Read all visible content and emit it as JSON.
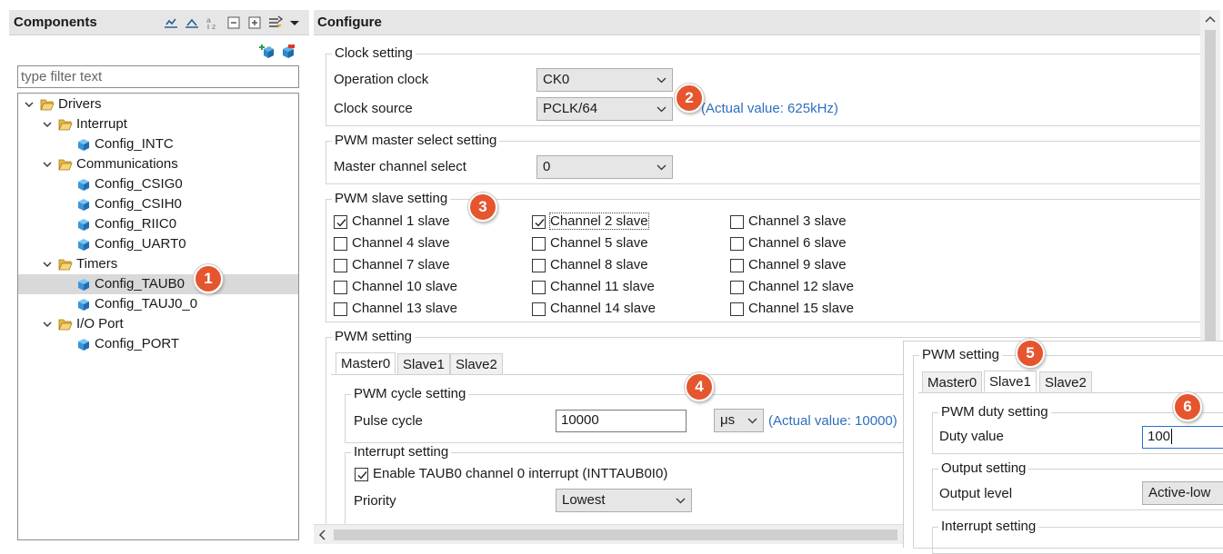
{
  "components": {
    "title": "Components",
    "filter_placeholder": "type filter text",
    "tree": [
      {
        "label": "Drivers"
      },
      {
        "label": "Interrupt"
      },
      {
        "label": "Config_INTC"
      },
      {
        "label": "Communications"
      },
      {
        "label": "Config_CSIG0"
      },
      {
        "label": "Config_CSIH0"
      },
      {
        "label": "Config_RIIC0"
      },
      {
        "label": "Config_UART0"
      },
      {
        "label": "Timers"
      },
      {
        "label": "Config_TAUB0"
      },
      {
        "label": "Config_TAUJ0_0"
      },
      {
        "label": "I/O Port"
      },
      {
        "label": "Config_PORT"
      }
    ]
  },
  "badges": [
    "1",
    "2",
    "3",
    "4",
    "5",
    "6"
  ],
  "configure": {
    "title": "Configure",
    "clock": {
      "legend": "Clock setting",
      "operation_clock_label": "Operation clock",
      "operation_clock_value": "CK0",
      "clock_source_label": "Clock source",
      "clock_source_value": "PCLK/64",
      "actual_value": "(Actual value: 625kHz)"
    },
    "master_select": {
      "legend": "PWM master select setting",
      "label": "Master channel select",
      "value": "0"
    },
    "slave": {
      "legend": "PWM slave setting",
      "channels": [
        {
          "label": "Channel 1 slave",
          "checked": true
        },
        {
          "label": "Channel 2 slave",
          "checked": true
        },
        {
          "label": "Channel 3 slave",
          "checked": false
        },
        {
          "label": "Channel 4 slave",
          "checked": false
        },
        {
          "label": "Channel 5 slave",
          "checked": false
        },
        {
          "label": "Channel 6 slave",
          "checked": false
        },
        {
          "label": "Channel 7 slave",
          "checked": false
        },
        {
          "label": "Channel 8 slave",
          "checked": false
        },
        {
          "label": "Channel 9 slave",
          "checked": false
        },
        {
          "label": "Channel 10 slave",
          "checked": false
        },
        {
          "label": "Channel 11 slave",
          "checked": false
        },
        {
          "label": "Channel 12 slave",
          "checked": false
        },
        {
          "label": "Channel 13 slave",
          "checked": false
        },
        {
          "label": "Channel 14 slave",
          "checked": false
        },
        {
          "label": "Channel 15 slave",
          "checked": false
        }
      ]
    },
    "pwm": {
      "legend": "PWM setting",
      "tabs": [
        "Master0",
        "Slave1",
        "Slave2"
      ],
      "active_tab": "Master0",
      "cycle": {
        "legend": "PWM cycle setting",
        "pulse_label": "Pulse cycle",
        "pulse_value": "10000",
        "unit": "μs",
        "actual_value": "(Actual value: 10000)"
      },
      "interrupt": {
        "legend": "Interrupt setting",
        "enable_label": "Enable TAUB0 channel 0 interrupt (INTTAUB0I0)",
        "enable_checked": true,
        "priority_label": "Priority",
        "priority_value": "Lowest"
      }
    }
  },
  "overlay": {
    "legend": "PWM setting",
    "tabs": [
      "Master0",
      "Slave1",
      "Slave2"
    ],
    "active_tab": "Slave1",
    "duty": {
      "legend": "PWM duty setting",
      "label": "Duty value",
      "value": "100"
    },
    "output": {
      "legend": "Output setting",
      "label": "Output level",
      "value": "Active-low"
    },
    "interrupt": {
      "legend": "Interrupt setting"
    }
  }
}
